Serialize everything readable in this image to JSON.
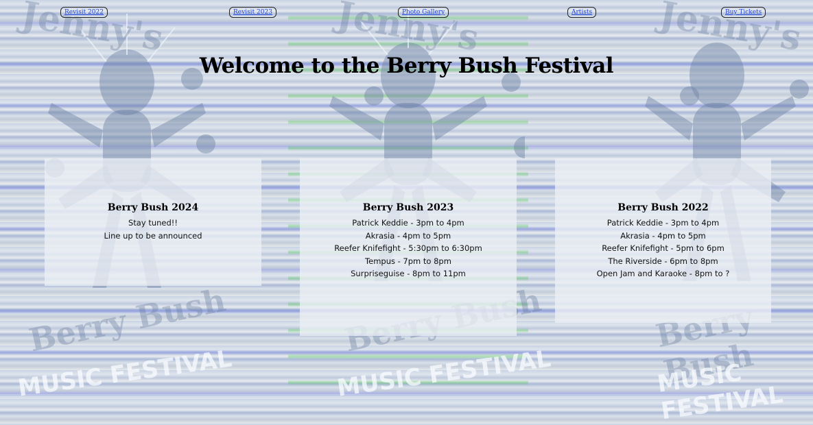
{
  "nav": {
    "links": [
      {
        "label": "Revisit 2022"
      },
      {
        "label": "Revisit 2023"
      },
      {
        "label": "Photo Gallery"
      },
      {
        "label": "Artists"
      },
      {
        "label": "Buy Tickets"
      }
    ]
  },
  "page_title": "Welcome to the Berry Bush Festival",
  "background": {
    "logo_text_top": "Jenny's",
    "logo_text_mid": "Berry Bush",
    "logo_text_bottom": "MUSIC FESTIVAL"
  },
  "cards": [
    {
      "title": "Berry Bush 2024",
      "lines": [
        "Stay tuned!!",
        "Line up to be announced"
      ]
    },
    {
      "title": "Berry Bush 2023",
      "lines": [
        "Patrick Keddie - 3pm to 4pm",
        "Akrasia - 4pm to 5pm",
        "Reefer Knifefight - 5:30pm to 6:30pm",
        "Tempus - 7pm to 8pm",
        "Surpriseguise - 8pm to 11pm"
      ]
    },
    {
      "title": "Berry Bush 2022",
      "lines": [
        "Patrick Keddie - 3pm to 4pm",
        "Akrasia - 4pm to 5pm",
        "Reefer Knifefight - 5pm to 6pm",
        "The Riverside - 6pm to 8pm",
        "Open Jam and Karaoke - 8pm to ?"
      ]
    }
  ],
  "colors": {
    "link": "#1a3fd6",
    "text": "#000000",
    "card_bg": "rgba(236,240,245,0.78)"
  }
}
